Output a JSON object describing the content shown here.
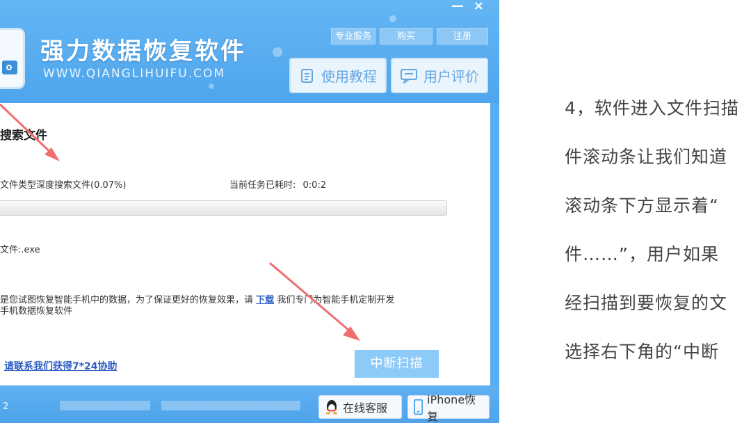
{
  "window": {
    "minimize_label": "—",
    "close_label": "×",
    "app_title": "强力数据恢复软件",
    "app_url": "WWW.QIANGLIHUIFU.COM"
  },
  "top_links": [
    "专业服务",
    "购买",
    "注册"
  ],
  "toolbar": {
    "tutorial_label": "使用教程",
    "review_label": "用户评价"
  },
  "scan": {
    "section_title": "搜索文件",
    "status_text": "文件类型深度搜索文件(0.07%)",
    "elapsed_label": "当前任务已耗时:",
    "elapsed_value": "0:0:2",
    "progress_percent": 0.07,
    "current_file": "文件:.exe",
    "notice_prefix": "是您试图恢复智能手机中的数据，为了保证更好的恢复效果，请",
    "notice_link": "下载",
    "notice_suffix": "我们专门为智能手机定制开发",
    "notice_line2": "手机数据恢复软件",
    "support_link": "请联系我们获得7*24协助",
    "stop_button": "中断扫描"
  },
  "footer": {
    "version": "2",
    "online_service": "在线客服",
    "iphone_recovery": "iPhone恢复"
  },
  "doc_text": [
    "4，软件进入文件扫描",
    "件滚动条让我们知道",
    "滚动条下方显示着“",
    "件……”，用户如果",
    "经扫描到要恢复的文",
    "选择右下角的“中断"
  ],
  "colors": {
    "header_blue": "#5aaef0",
    "link_blue": "#2f5fc4",
    "stop_button": "#8ccbf7",
    "annotation_arrow": "#ef6f6f"
  }
}
